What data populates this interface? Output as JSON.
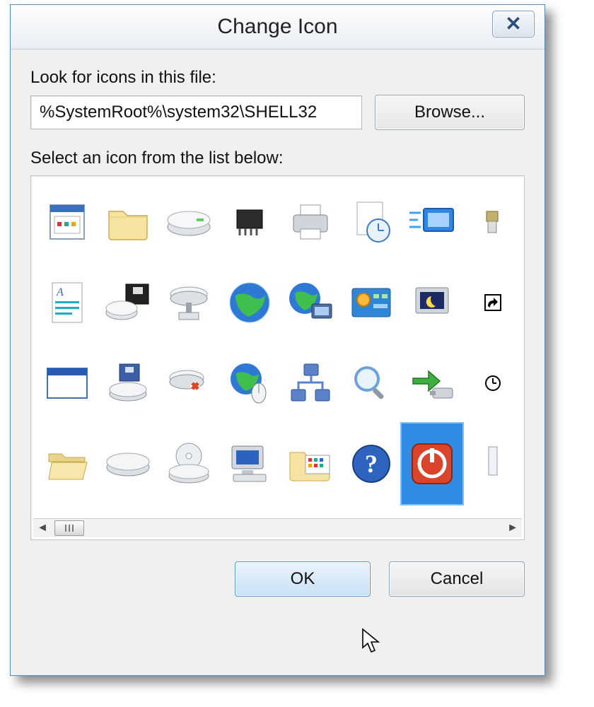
{
  "dialog": {
    "title": "Change Icon",
    "look_label": "Look for icons in this file:",
    "path_value": "%SystemRoot%\\system32\\SHELL32",
    "browse_label": "Browse...",
    "select_label": "Select an icon from the list below:",
    "ok_label": "OK",
    "cancel_label": "Cancel"
  },
  "icons": [
    "program-window",
    "folder",
    "drive",
    "chip",
    "printer",
    "doc-clock",
    "screen",
    "connector",
    "text-doc",
    "floppy-drive",
    "network-drive",
    "globe",
    "globe-pc",
    "control-panel",
    "screensaver",
    "shortcut-arrow",
    "blank-window",
    "drive-floppy",
    "drive-error",
    "globe-mouse",
    "network",
    "search",
    "usb-arrow",
    "clock",
    "open-folder",
    "closed-drive",
    "optical-drive",
    "computer",
    "folder-apps",
    "help",
    "power",
    "cert"
  ],
  "selected_index": 30
}
